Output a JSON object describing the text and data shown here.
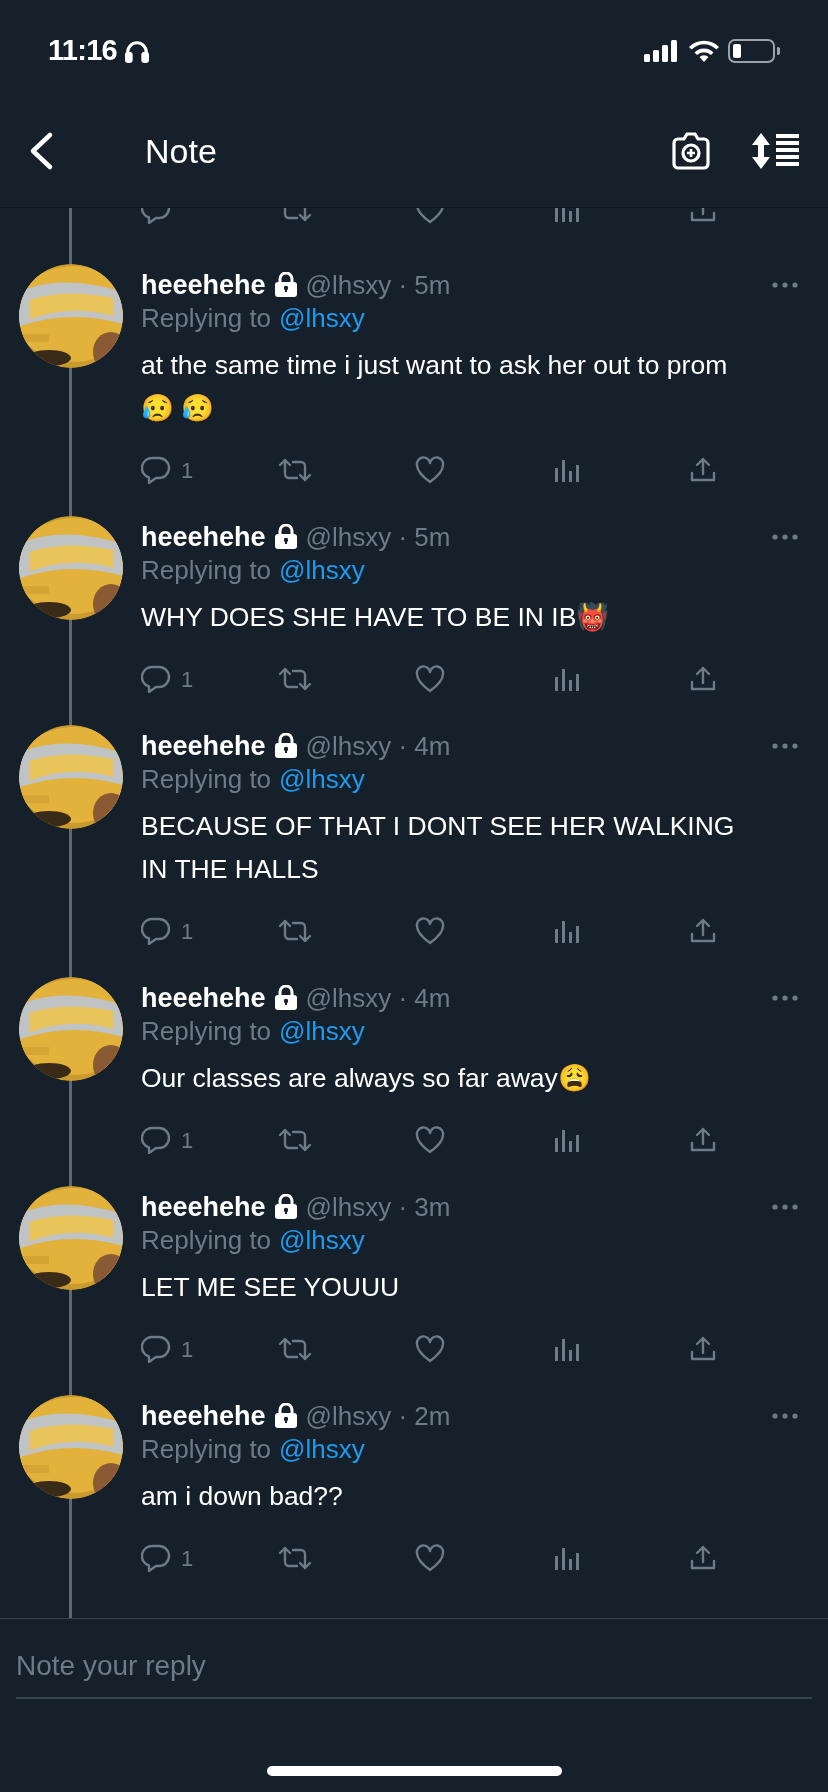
{
  "status_bar": {
    "time": "11:16"
  },
  "header": {
    "title": "Note"
  },
  "tweets": [
    {
      "name": "heeehehe",
      "handle": "@lhsxy · 5m",
      "replying_label": "Replying to",
      "replying_to": "@lhsxy",
      "text": "at the same time i just want to ask her out to prom😥 😥",
      "reply_count": "1"
    },
    {
      "name": "heeehehe",
      "handle": "@lhsxy · 5m",
      "replying_label": "Replying to",
      "replying_to": "@lhsxy",
      "text": "WHY DOES SHE HAVE TO BE IN IB👹",
      "reply_count": "1"
    },
    {
      "name": "heeehehe",
      "handle": "@lhsxy · 4m",
      "replying_label": "Replying to",
      "replying_to": "@lhsxy",
      "text": "BECAUSE OF THAT I DONT SEE HER WALKING IN THE HALLS",
      "reply_count": "1"
    },
    {
      "name": "heeehehe",
      "handle": "@lhsxy · 4m",
      "replying_label": "Replying to",
      "replying_to": "@lhsxy",
      "text": "Our classes are always so far away😩",
      "reply_count": "1"
    },
    {
      "name": "heeehehe",
      "handle": "@lhsxy · 3m",
      "replying_label": "Replying to",
      "replying_to": "@lhsxy",
      "text": "LET ME SEE YOUUU",
      "reply_count": "1"
    },
    {
      "name": "heeehehe",
      "handle": "@lhsxy · 2m",
      "replying_label": "Replying to",
      "replying_to": "@lhsxy",
      "text": "am i down bad??",
      "reply_count": "1"
    }
  ],
  "composer": {
    "placeholder": "Note your reply"
  }
}
